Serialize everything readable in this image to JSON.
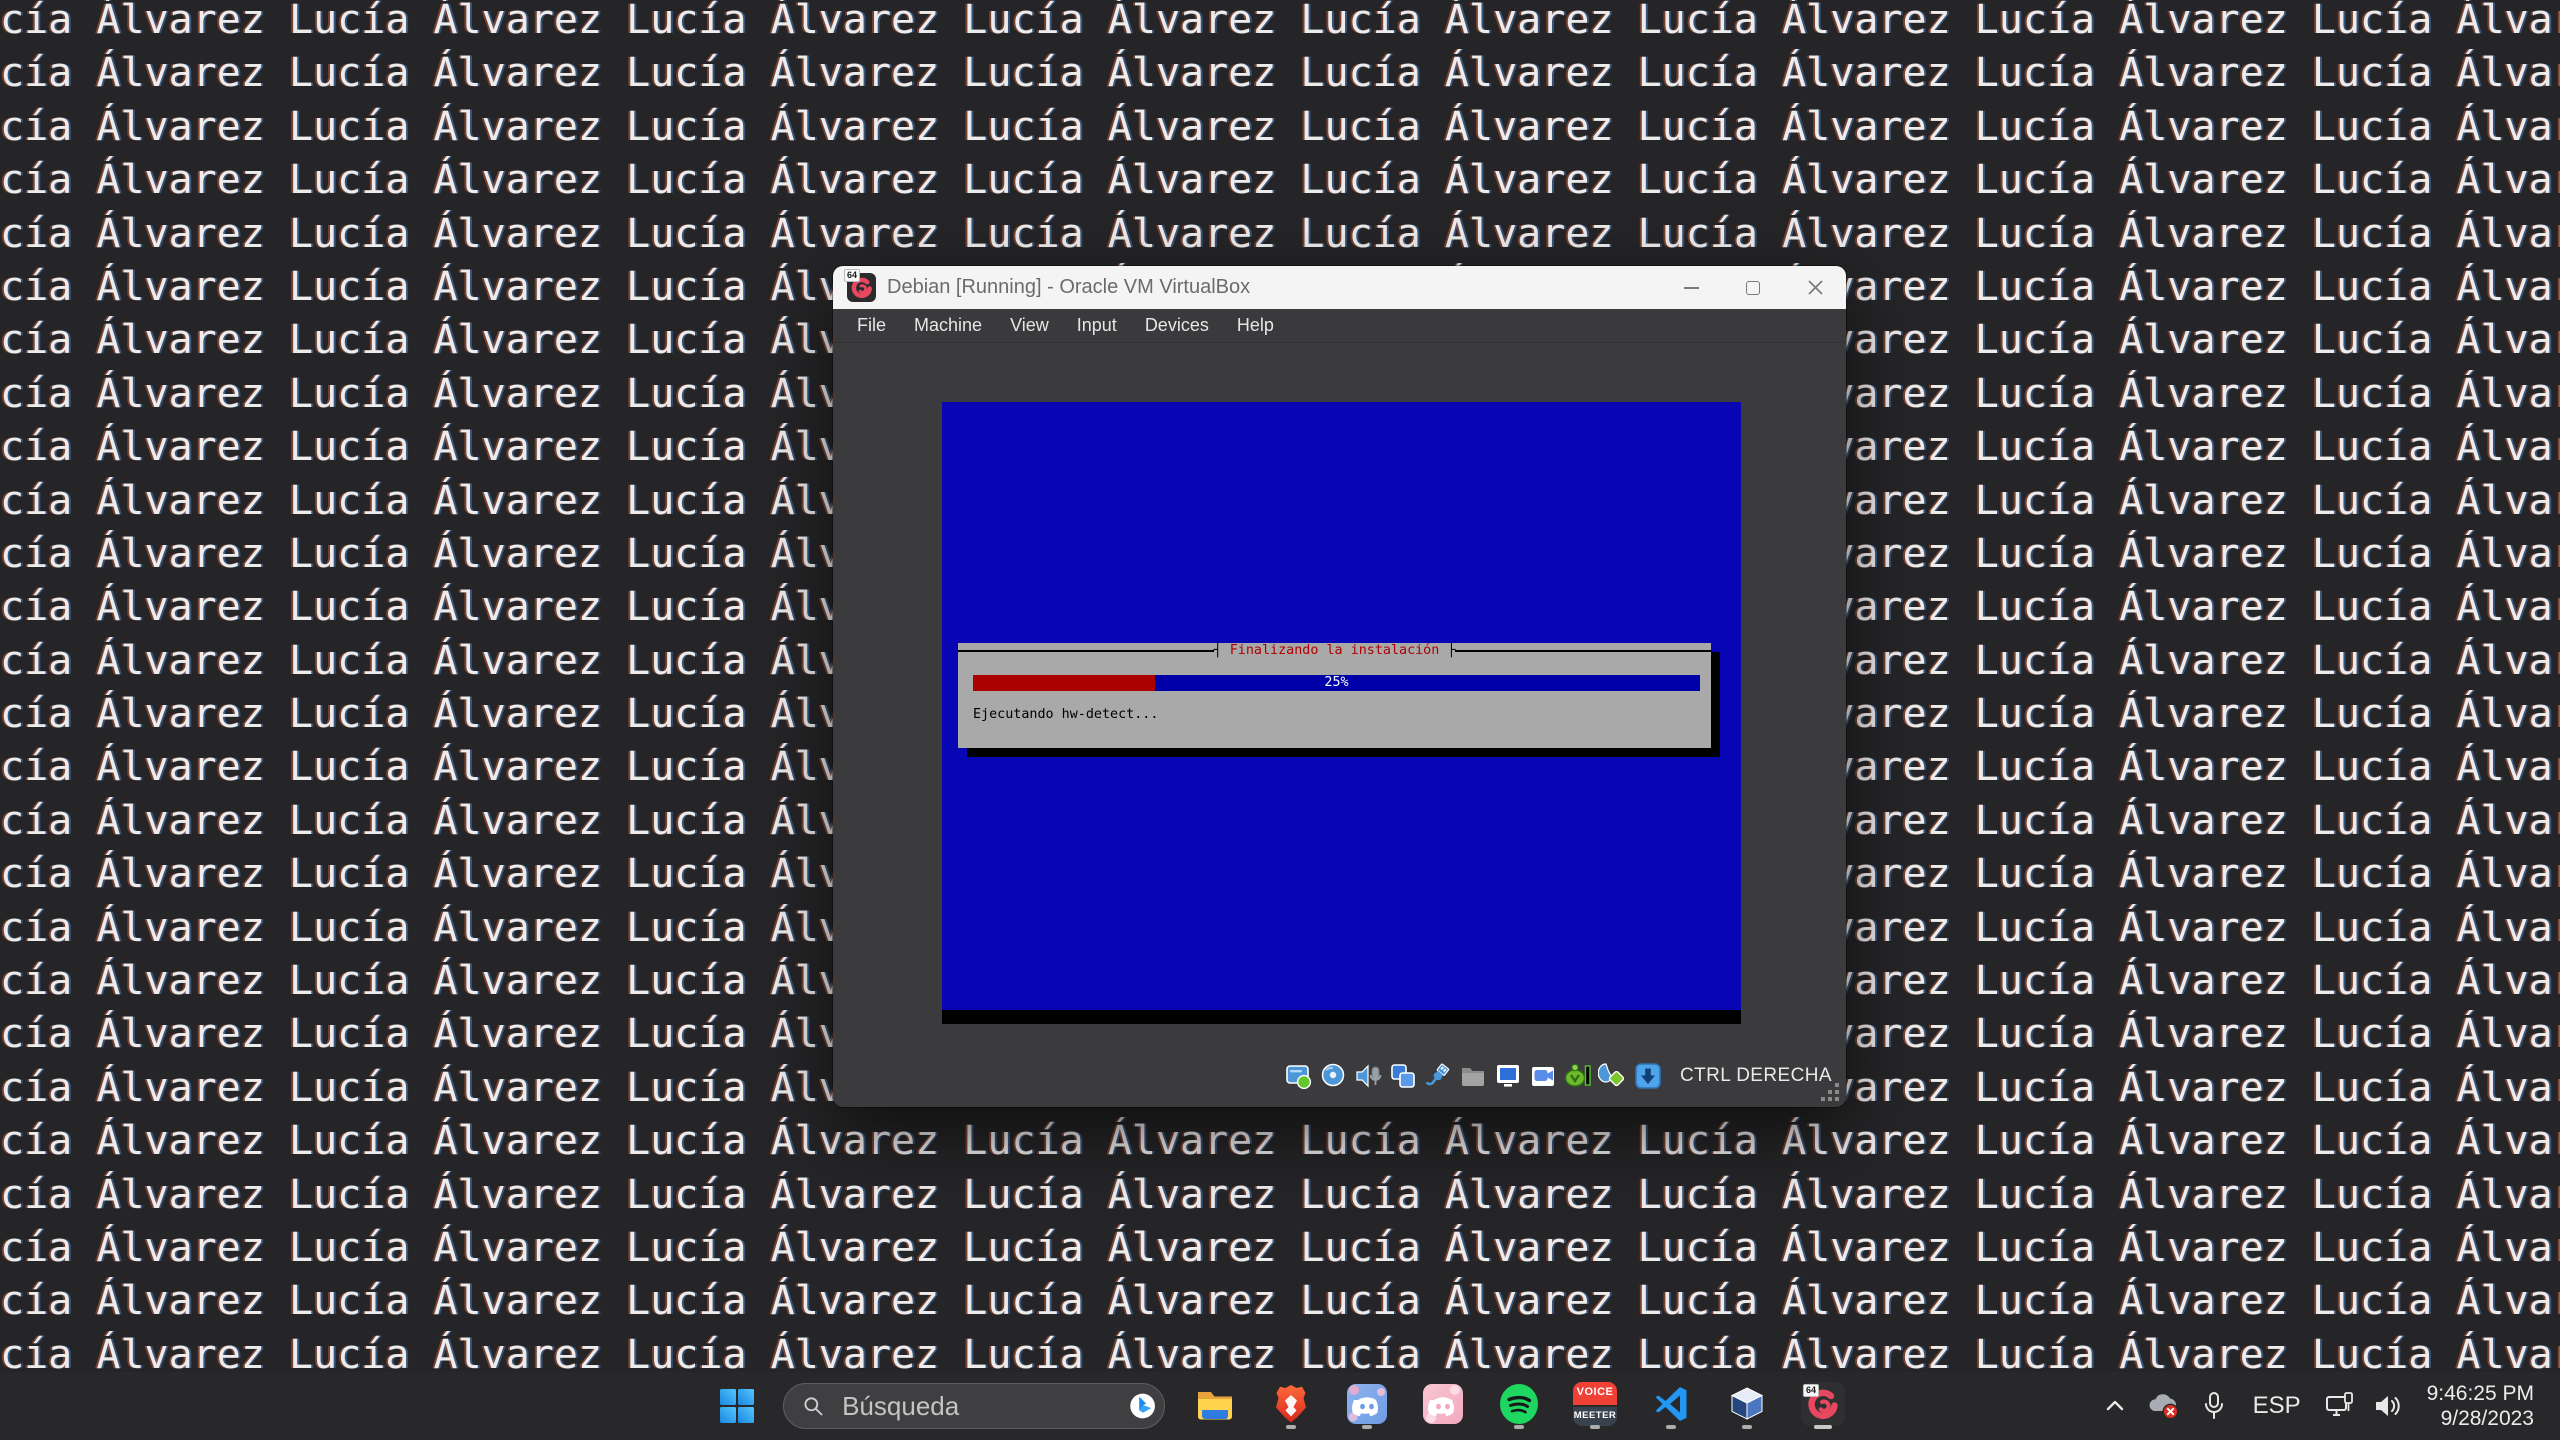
{
  "background": {
    "phrase": "Lucía Álvarez",
    "rows": 27,
    "reps": 10
  },
  "vbox_window": {
    "title": "Debian [Running] - Oracle VM VirtualBox",
    "arch_badge": "64",
    "menu": [
      "File",
      "Machine",
      "View",
      "Input",
      "Devices",
      "Help"
    ],
    "host_key_label": "CTRL DERECHA"
  },
  "installer": {
    "dialog_title": "Finalizando la instalación",
    "tee_left": "┤",
    "tee_right": "├",
    "progress_percent": 25,
    "progress_label": "25%",
    "status_text": "Ejecutando hw-detect...",
    "colors": {
      "screen_blue": "#0806b4",
      "dialog_gray": "#a9a9a9",
      "bar_fill_red": "#aa0000",
      "bar_rest_blue": "#0000a8",
      "title_red": "#ae0000"
    }
  },
  "taskbar": {
    "search_placeholder": "Búsqueda",
    "voicemeeter_label_top": "VOICE",
    "voicemeeter_label_bottom": "MEETER",
    "debian_badge": "64",
    "apps": [
      {
        "name": "file-explorer",
        "running": false
      },
      {
        "name": "brave",
        "running": true
      },
      {
        "name": "discord",
        "running": true
      },
      {
        "name": "discord-alt",
        "running": false
      },
      {
        "name": "spotify",
        "running": true
      },
      {
        "name": "voicemeeter",
        "running": true
      },
      {
        "name": "vscode",
        "running": true
      },
      {
        "name": "virtualbox",
        "running": true
      },
      {
        "name": "debian-vm",
        "running": true,
        "active": true
      }
    ],
    "tray": {
      "language": "ESP",
      "time": "9:46:25 PM",
      "date": "9/28/2023"
    }
  }
}
